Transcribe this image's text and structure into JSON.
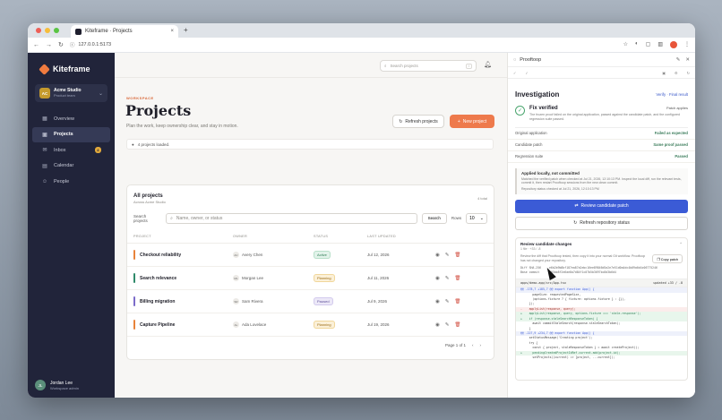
{
  "browser": {
    "tab_title": "Kiteframe · Projects",
    "tab_close": "×",
    "new_tab": "+",
    "url": "127.0.0.1:5173",
    "nav_back": "←",
    "nav_forward": "→",
    "nav_reload": "↻"
  },
  "sidebar": {
    "brand": "Kiteframe",
    "workspace_initials": "AC",
    "workspace_name": "Acme Studio",
    "workspace_sub": "Product team",
    "items": [
      {
        "label": "Overview",
        "icon": "▦"
      },
      {
        "label": "Projects",
        "icon": "▣"
      },
      {
        "label": "Inbox",
        "icon": "✉",
        "badge": "4"
      },
      {
        "label": "Calendar",
        "icon": "▤"
      },
      {
        "label": "People",
        "icon": "☺"
      }
    ],
    "user_initials": "JL",
    "user_name": "Jordan Lee",
    "user_role": "Workspace admin"
  },
  "main": {
    "search_placeholder": "Search projects",
    "search_kbd": "/",
    "eyebrow": "WORKSPACE",
    "title": "Projects",
    "subtitle": "Plan the work, keep ownership clear, and stay in motion.",
    "refresh_label": "Refresh projects",
    "new_label": "New project",
    "loaded_text": "4 projects loaded.",
    "card_title": "All projects",
    "card_sub": "Across Acme Studio",
    "card_total": "4 total",
    "filter_label": "Search projects",
    "filter_placeholder": "Name, owner, or status",
    "search_btn": "Search",
    "rows_label": "Rows",
    "rows_value": "10",
    "columns": [
      "PROJECT",
      "OWNER",
      "STATUS",
      "LAST UPDATED"
    ],
    "rows": [
      {
        "name": "Checkout reliability",
        "color": "#e8833a",
        "owner_initials": "AC",
        "owner": "Avery Chen",
        "status": "Active",
        "status_class": "st-active",
        "updated": "Jul 12, 2026"
      },
      {
        "name": "Search relevance",
        "color": "#2f8a6a",
        "owner_initials": "ML",
        "owner": "Morgan Lee",
        "status": "Planning",
        "status_class": "st-planning",
        "updated": "Jul 11, 2026"
      },
      {
        "name": "Billing migration",
        "color": "#7b6bc9",
        "owner_initials": "SR",
        "owner": "Sam Rivera",
        "status": "Paused",
        "status_class": "st-paused",
        "updated": "Jul 9, 2026"
      },
      {
        "name": "Capture Pipeline",
        "color": "#e8833a",
        "owner_initials": "AL",
        "owner": "Ada Lovelace",
        "status": "Planning",
        "status_class": "st-planning",
        "updated": "Jul 19, 2026"
      }
    ],
    "pager_text": "Page 1 of 1",
    "pager_prev": "‹",
    "pager_next": "›"
  },
  "panel": {
    "title": "Prooftoop",
    "investigation": "Investigation",
    "verify_link": "Verify · Final result",
    "fix_title": "Fix verified",
    "fix_tag": "Patch applies",
    "fix_text": "The frozen proof failed on the original application, passed against the candidate patch, and the configured regression suite passed.",
    "kv": [
      {
        "k": "Original application",
        "v": "Failed as expected"
      },
      {
        "k": "Candidate patch",
        "v": "Same proof passed"
      },
      {
        "k": "Regression suite",
        "v": "Passed"
      }
    ],
    "local_title": "Applied locally, not committed",
    "local_text": "Matched the verified patch when checked at Jul 21, 2026, 12:10:13 PM. Inspect the local diff, run the relevant tests, commit it, then restart Prooftoop sessions from the new clean commit.",
    "local_time": "Repository status checked at Jul 21, 2026, 12:10:13 PM",
    "review_btn": "Review candidate patch",
    "repo_btn": "Refresh repository status",
    "changes_title": "Review candidate changes",
    "changes_sub": "1 file · +33 / -8",
    "changes_desc": "Review the diff that Prooftoop tested, then copy it into your normal Git workflow. Prooftoop has not changed your repository.",
    "copy_btn": "Copy patch",
    "diff_sha_label": "Diff SHA-256",
    "diff_sha": "e6b2b9b8bf187ea87a2ebc16ee89846d5a2e7e51d0a4dc4b09a0d4c06775246",
    "base_label": "Base commit",
    "base_sha": "f05bb8f2e6ae8a7d84f1c07b5b3697bc8d3b6d4",
    "file_name": "apps/demo-app/src/App.tsx",
    "file_stat": "updated +33 / -8",
    "diff": [
      {
        "t": "hunk",
        "s": "@@ -178,7 +185,7 @@ export function App() {"
      },
      {
        "t": "ctx",
        "s": "       pageSize: requestedPageSize,"
      },
      {
        "t": "ctx",
        "s": "       (options.fixture ? { fixture: options.fixture } : {}),"
      },
      {
        "t": "ctx",
        "s": "     });"
      },
      {
        "t": "del",
        "s": "-    applyList(response, query);"
      },
      {
        "t": "add",
        "s": "+    applyList(response, query, options.fixture === 'stale-response');"
      },
      {
        "t": "add",
        "s": "+    if (response.staleSearchResponseToken) {"
      },
      {
        "t": "ctx",
        "s": "       await commitStaleSearch(response.staleSearchToken);"
      },
      {
        "t": "ctx",
        "s": "     }"
      },
      {
        "t": "hunk",
        "s": "@@ -227,9 +234,7 @@ export function App() {"
      },
      {
        "t": "ctx",
        "s": "     setStatusMessage('Creating project');"
      },
      {
        "t": "ctx",
        "s": "     try {"
      },
      {
        "t": "ctx",
        "s": "       const { project, staleResponseToken } = await createProject();"
      },
      {
        "t": "add",
        "s": "+      pendingCreatedProjectIdRef.current.add(project.id);"
      },
      {
        "t": "ctx",
        "s": "       setProjects((current) => [project, ...current]);"
      }
    ]
  },
  "colors": {
    "sidebar_bg": "#21243a",
    "accent_orange": "#ee7a4c",
    "accent_blue": "#3b5bd6"
  }
}
